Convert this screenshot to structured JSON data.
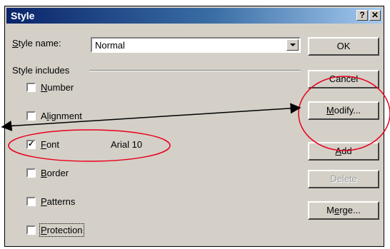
{
  "dialog": {
    "title": "Style",
    "help_button": "?",
    "close_button": "✕"
  },
  "style_name": {
    "label_underlined": "S",
    "label_rest": "tyle name:",
    "value": "Normal"
  },
  "style_includes": {
    "label": "Style includes",
    "items": [
      {
        "name": "Number",
        "mnemonic": "N",
        "rest": "umber",
        "checked": false
      },
      {
        "name": "Alignment",
        "mnemonic": "l",
        "pre": "A",
        "rest": "ignment",
        "checked": false
      },
      {
        "name": "Font",
        "mnemonic": "F",
        "rest": "ont",
        "checked": true,
        "detail": "Arial 10"
      },
      {
        "name": "Border",
        "mnemonic": "B",
        "rest": "order",
        "checked": false
      },
      {
        "name": "Patterns",
        "mnemonic": "P",
        "rest": "atterns",
        "checked": false
      },
      {
        "name": "Protection",
        "mnemonic": "P",
        "rest": "rotection",
        "checked": false
      }
    ]
  },
  "buttons": {
    "ok": "OK",
    "cancel": "Cancel",
    "modify_mnemonic": "M",
    "modify_rest": "odify...",
    "add_mnemonic": "A",
    "add_rest": "dd",
    "delete": "Delete",
    "merge_pre": "M",
    "merge_mnemonic": "e",
    "merge_rest": "rge..."
  },
  "annotation_colors": {
    "ellipse": "#e8001c",
    "arrow": "#000000"
  }
}
